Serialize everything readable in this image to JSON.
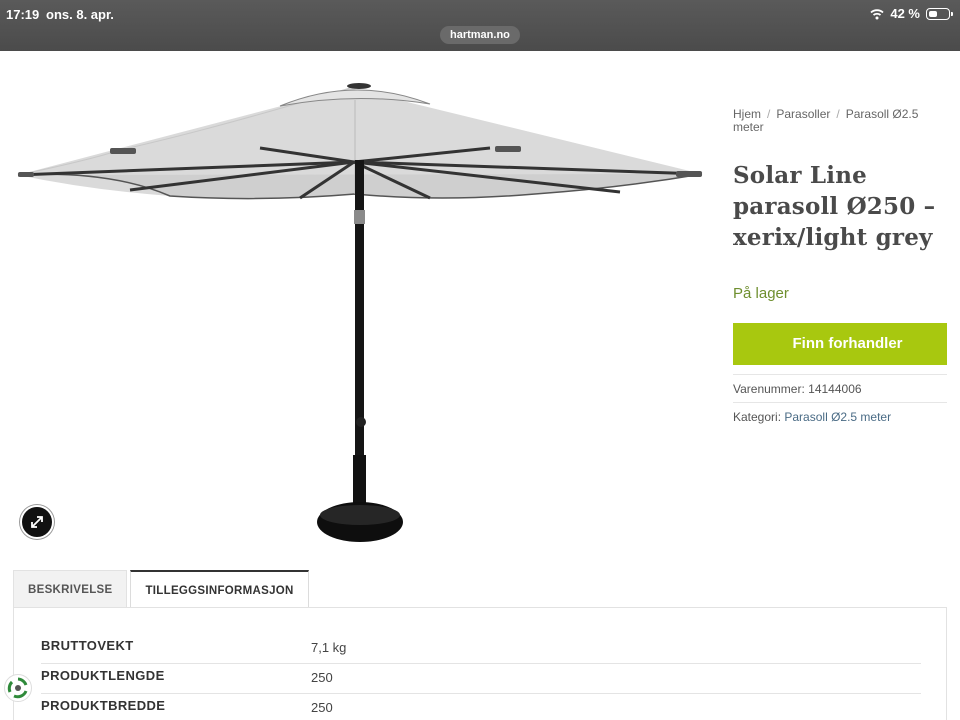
{
  "status_bar": {
    "time": "17:19",
    "date": "ons. 8. apr.",
    "battery": "42 %",
    "url": "hartman.no"
  },
  "breadcrumb": {
    "items": [
      "Hjem",
      "Parasoller",
      "Parasoll Ø2.5 meter"
    ]
  },
  "product": {
    "title": "Solar Line parasoll Ø250 – xerix/light grey",
    "stock": "På lager",
    "cta_label": "Finn forhandler",
    "sku_label": "Varenummer:",
    "sku": "14144006",
    "category_label": "Kategori:",
    "category": "Parasoll Ø2.5 meter"
  },
  "tabs": [
    {
      "label": "BESKRIVELSE",
      "active": false
    },
    {
      "label": "TILLEGGSINFORMASJON",
      "active": true
    }
  ],
  "attributes": [
    {
      "label": "BRUTTOVEKT",
      "value": "7,1 kg"
    },
    {
      "label": "PRODUKTLENGDE",
      "value": "250"
    },
    {
      "label": "PRODUKTBREDDE",
      "value": "250"
    }
  ],
  "icons": {
    "wifi": "wifi-icon",
    "battery": "battery-icon",
    "zoom": "expand-icon",
    "badge": "recycle-icon"
  },
  "colors": {
    "accent": "#a8c80f",
    "stock": "#6f8f2f",
    "link": "#4a6b85"
  }
}
